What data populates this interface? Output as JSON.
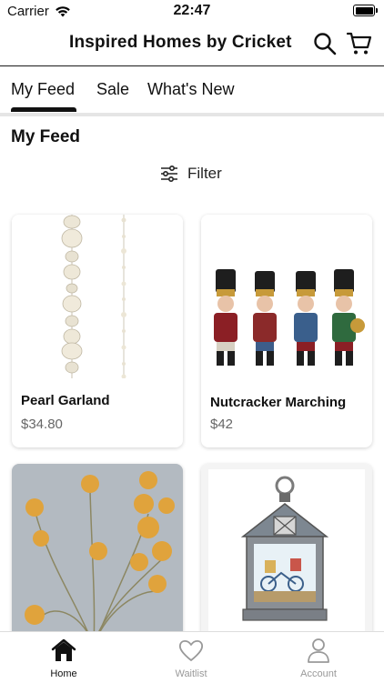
{
  "status_bar": {
    "carrier": "Carrier",
    "time": "22:47"
  },
  "header": {
    "title": "Inspired Homes by Cricket",
    "icons": [
      "search-icon",
      "cart-icon"
    ]
  },
  "tabs": [
    {
      "label": "My Feed",
      "selected": true
    },
    {
      "label": "Sale",
      "selected": false
    },
    {
      "label": "What's New",
      "selected": false
    }
  ],
  "feed": {
    "title": "My Feed",
    "filter_label": "Filter",
    "products": [
      {
        "name": "Pearl Garland",
        "price": "$34.80"
      },
      {
        "name": "Nutcracker Marching",
        "price": "$42"
      },
      {
        "name": "",
        "price": ""
      },
      {
        "name": "",
        "price": ""
      }
    ]
  },
  "tab_bar": {
    "items": [
      {
        "label": "Home",
        "icon": "home-icon",
        "active": true
      },
      {
        "label": "Waitlist",
        "icon": "heart-icon",
        "active": false
      },
      {
        "label": "Account",
        "icon": "person-icon",
        "active": false
      }
    ]
  },
  "colors": {
    "text": "#111111",
    "muted": "#666666",
    "divider": "#e5e5e5",
    "tab_inactive": "#999999"
  }
}
